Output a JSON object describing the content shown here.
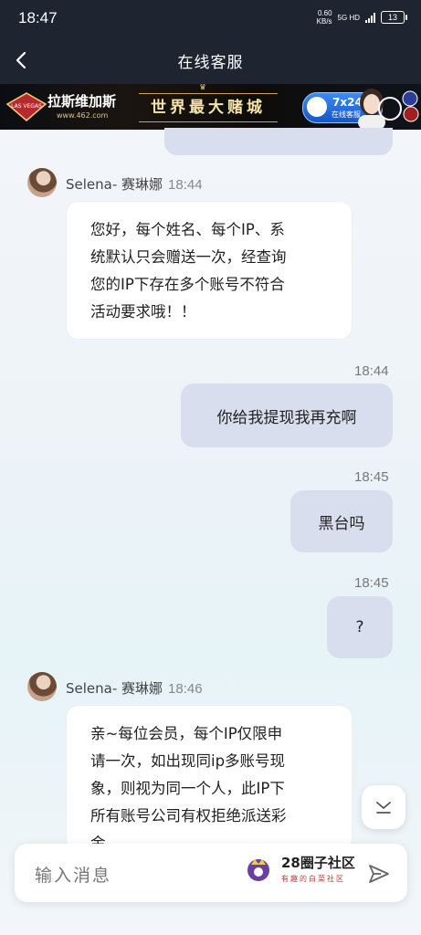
{
  "status_bar": {
    "time": "18:47",
    "net_speed": "0.60",
    "net_unit": "KB/s",
    "network": "5G HD",
    "battery": "13"
  },
  "nav": {
    "title": "在线客服",
    "back_icon": "chevron-left-icon"
  },
  "banner": {
    "brand": "拉斯维加斯",
    "url": "www.462.com",
    "logo_text": "LAS VEGAS",
    "slogan": "世界最大赌城",
    "service_hours": "7x24",
    "service_label": "在线客服"
  },
  "messages": [
    {
      "side": "right",
      "text": "",
      "partial": true
    },
    {
      "side": "left",
      "sender": "Selena- 赛琳娜",
      "time": "18:44",
      "lines": [
        "您好，每个姓名、每个IP、系",
        "统默认只会赠送一次，经查询",
        "您的IP下存在多个账号不符合",
        "活动要求哦！！"
      ]
    },
    {
      "side": "right",
      "time": "18:44",
      "text": "你给我提现我再充啊"
    },
    {
      "side": "right",
      "time": "18:45",
      "text": "黑台吗"
    },
    {
      "side": "right",
      "time": "18:45",
      "text": "?"
    },
    {
      "side": "left",
      "sender": "Selena- 赛琳娜",
      "time": "18:46",
      "lines": [
        "亲~每位会员，每个IP仅限申",
        "请一次，如出现同ip多账号现",
        "象，则视为同一个人，此IP下",
        "所有账号公司有权拒绝派送彩",
        "金。"
      ]
    }
  ],
  "input": {
    "placeholder": "输入消息",
    "send_icon": "send-icon"
  },
  "watermark": {
    "title": "28圈子社区",
    "subtitle": "有趣的白菜社区"
  },
  "scroll_down_icon": "chevron-down-icon",
  "colors": {
    "header_bg": "#1e2430",
    "bubble_right": "#d9deee",
    "bubble_left": "#ffffff"
  }
}
